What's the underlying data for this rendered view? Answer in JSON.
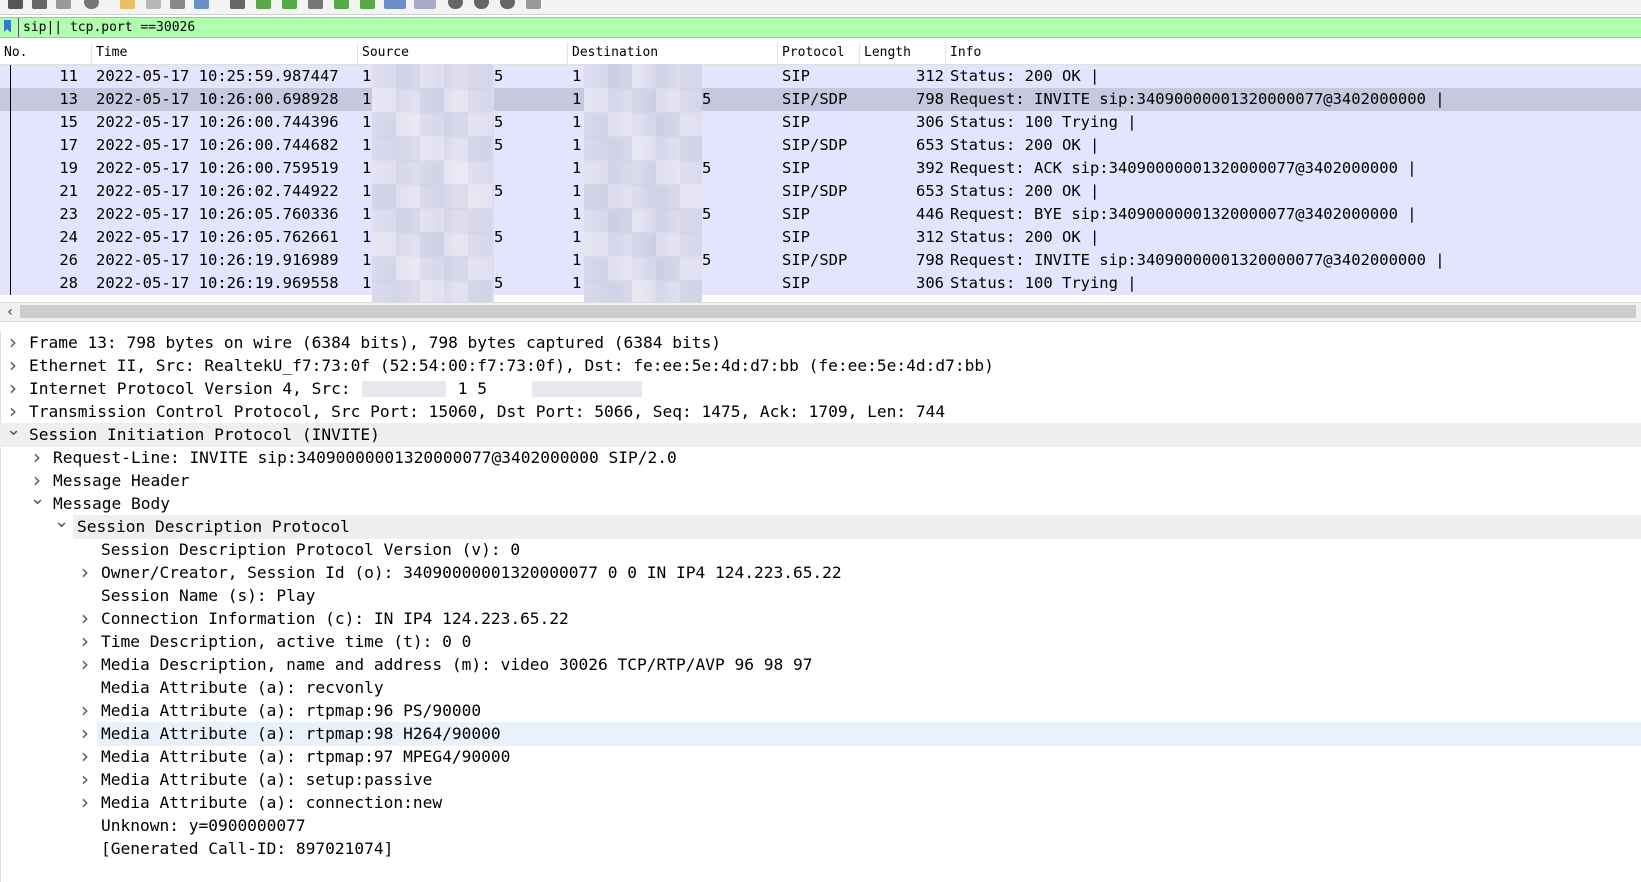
{
  "filter": {
    "value": "sip|| tcp.port ==30026"
  },
  "packet_list": {
    "columns": [
      "No.",
      "Time",
      "Source",
      "Destination",
      "Protocol",
      "Length",
      "Info"
    ],
    "rows": [
      {
        "no": "11",
        "time": "2022-05-17 10:25:59.987447",
        "src": "1",
        "src_tail": "5",
        "dst": "1",
        "dst_tail": "",
        "proto": "SIP",
        "len": "312",
        "info": "Status: 200 OK |"
      },
      {
        "no": "13",
        "time": "2022-05-17 10:26:00.698928",
        "src": "1",
        "src_tail": "",
        "dst": "1",
        "dst_tail": "5",
        "proto": "SIP/SDP",
        "len": "798",
        "info": "Request: INVITE sip:34090000001320000077@3402000000 |",
        "selected": true
      },
      {
        "no": "15",
        "time": "2022-05-17 10:26:00.744396",
        "src": "1",
        "src_tail": "5",
        "dst": "1",
        "dst_tail": "",
        "proto": "SIP",
        "len": "306",
        "info": "Status: 100 Trying |"
      },
      {
        "no": "17",
        "time": "2022-05-17 10:26:00.744682",
        "src": "1",
        "src_tail": "5",
        "dst": "1",
        "dst_tail": "",
        "proto": "SIP/SDP",
        "len": "653",
        "info": "Status: 200 OK |"
      },
      {
        "no": "19",
        "time": "2022-05-17 10:26:00.759519",
        "src": "1",
        "src_tail": "",
        "dst": "1",
        "dst_tail": "5",
        "proto": "SIP",
        "len": "392",
        "info": "Request: ACK sip:34090000001320000077@3402000000 |"
      },
      {
        "no": "21",
        "time": "2022-05-17 10:26:02.744922",
        "src": "1",
        "src_tail": "5",
        "dst": "1",
        "dst_tail": "",
        "proto": "SIP/SDP",
        "len": "653",
        "info": "Status: 200 OK |"
      },
      {
        "no": "23",
        "time": "2022-05-17 10:26:05.760336",
        "src": "1",
        "src_tail": "",
        "dst": "1",
        "dst_tail": "5",
        "proto": "SIP",
        "len": "446",
        "info": "Request: BYE sip:34090000001320000077@3402000000 |"
      },
      {
        "no": "24",
        "time": "2022-05-17 10:26:05.762661",
        "src": "1",
        "src_tail": "5",
        "dst": "1",
        "dst_tail": "",
        "proto": "SIP",
        "len": "312",
        "info": "Status: 200 OK |"
      },
      {
        "no": "26",
        "time": "2022-05-17 10:26:19.916989",
        "src": "1",
        "src_tail": "",
        "dst": "1",
        "dst_tail": "5",
        "proto": "SIP/SDP",
        "len": "798",
        "info": "Request: INVITE sip:34090000001320000077@3402000000 |"
      },
      {
        "no": "28",
        "time": "2022-05-17 10:26:19.969558",
        "src": "1",
        "src_tail": "5",
        "dst": "1",
        "dst_tail": "",
        "proto": "SIP",
        "len": "306",
        "info": "Status: 100 Trying |"
      }
    ]
  },
  "details": {
    "rows": [
      {
        "level": 0,
        "chev": "right",
        "text": "Frame 13: 798 bytes on wire (6384 bits), 798 bytes captured (6384 bits)"
      },
      {
        "level": 0,
        "chev": "right",
        "text": "Ethernet II, Src: RealtekU_f7:73:0f (52:54:00:f7:73:0f), Dst: fe:ee:5e:4d:d7:bb (fe:ee:5e:4d:d7:bb)"
      },
      {
        "level": 0,
        "chev": "right",
        "text": "Internet Protocol Version 4, Src: 1          7, Dst: 1            5"
      },
      {
        "level": 0,
        "chev": "right",
        "text": "Transmission Control Protocol, Src Port: 15060, Dst Port: 5066, Seq: 1475, Ack: 1709, Len: 744"
      },
      {
        "level": 0,
        "chev": "down",
        "text": "Session Initiation Protocol (INVITE)",
        "hl": "hl1"
      },
      {
        "level": 1,
        "chev": "right",
        "text": "Request-Line: INVITE sip:34090000001320000077@3402000000 SIP/2.0"
      },
      {
        "level": 1,
        "chev": "right",
        "text": "Message Header"
      },
      {
        "level": 1,
        "chev": "down",
        "text": "Message Body"
      },
      {
        "level": 2,
        "chev": "down",
        "text": "Session Description Protocol",
        "hl": "hl1"
      },
      {
        "level": 3,
        "chev": "",
        "text": "Session Description Protocol Version (v): 0"
      },
      {
        "level": 3,
        "chev": "right",
        "text": "Owner/Creator, Session Id (o): 34090000001320000077 0 0 IN IP4 124.223.65.22"
      },
      {
        "level": 3,
        "chev": "",
        "text": "Session Name (s): Play"
      },
      {
        "level": 3,
        "chev": "right",
        "text": "Connection Information (c): IN IP4 124.223.65.22"
      },
      {
        "level": 3,
        "chev": "right",
        "text": "Time Description, active time (t): 0 0"
      },
      {
        "level": 3,
        "chev": "right",
        "text": "Media Description, name and address (m): video 30026 TCP/RTP/AVP 96 98 97"
      },
      {
        "level": 3,
        "chev": "",
        "text": "Media Attribute (a): recvonly"
      },
      {
        "level": 3,
        "chev": "right",
        "text": "Media Attribute (a): rtpmap:96 PS/90000"
      },
      {
        "level": 3,
        "chev": "right",
        "text": "Media Attribute (a): rtpmap:98 H264/90000",
        "hl": "hl2"
      },
      {
        "level": 3,
        "chev": "right",
        "text": "Media Attribute (a): rtpmap:97 MPEG4/90000"
      },
      {
        "level": 3,
        "chev": "right",
        "text": "Media Attribute (a): setup:passive"
      },
      {
        "level": 3,
        "chev": "right",
        "text": "Media Attribute (a): connection:new"
      },
      {
        "level": 3,
        "chev": "",
        "text": "Unknown: y=0900000077"
      },
      {
        "level": 3,
        "chev": "",
        "text": "[Generated Call-ID: 897021074]"
      }
    ]
  },
  "colors": {
    "filter_bg": "#afffaf",
    "row_bg": "#e4e4ff",
    "row_selected": "#c7c7dd",
    "tree_highlight": "#e9f2fc"
  },
  "icons": {
    "bookmark": "bookmark-icon",
    "expand": "chevron-right-icon",
    "collapse": "chevron-down-icon",
    "scroll_left": "scroll-left-icon"
  }
}
